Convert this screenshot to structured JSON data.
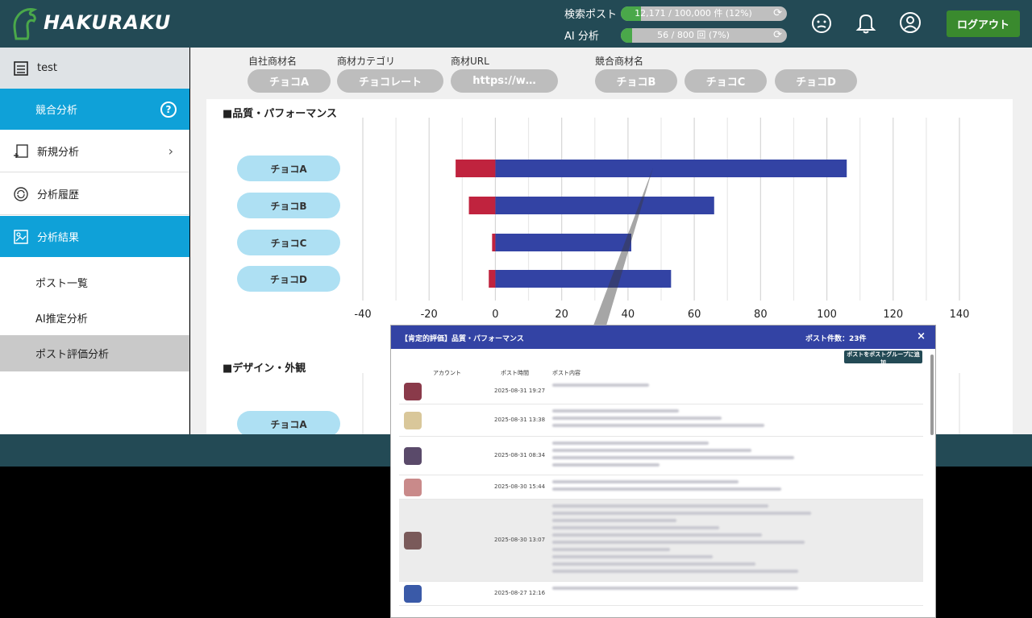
{
  "header": {
    "logo_text": "HAKURAKU",
    "search_posts": {
      "label": "検索ポスト",
      "value": "12,171 / 100,000 件 (12%)",
      "fraction": 0.12
    },
    "ai_analysis": {
      "label": "AI 分析",
      "value": "56 / 800 回 (7%)",
      "fraction": 0.07
    },
    "logout_label": "ログアウト"
  },
  "sidebar": {
    "project": "test",
    "competitive": "競合分析",
    "new_analysis": "新規分析",
    "history": "分析履歴",
    "results": "分析結果",
    "sub_items": [
      "ポスト一覧",
      "AI推定分析",
      "ポスト評価分析"
    ]
  },
  "filters": {
    "own_product_label": "自社商材名",
    "own_product": "チョコA",
    "category_label": "商材カテゴリ",
    "category": "チョコレート",
    "url_label": "商材URL",
    "url": "https://w…",
    "competitor_label": "競合商材名",
    "competitors": [
      "チョコB",
      "チョコC",
      "チョコD"
    ]
  },
  "sections": {
    "quality": "■品質・パフォーマンス",
    "design": "■デザイン・外観",
    "design_first_product": "チョコA"
  },
  "chart_data": {
    "type": "bar",
    "orientation": "horizontal",
    "categories": [
      "チョコA",
      "チョコB",
      "チョコC",
      "チョコD"
    ],
    "series": [
      {
        "values": [
          -12,
          -8,
          -1,
          -2
        ],
        "color": "#c0233e"
      },
      {
        "values": [
          106,
          66,
          41,
          53
        ],
        "color": "#3343a4"
      }
    ],
    "xlim": [
      -40,
      140
    ],
    "xticks": [
      -40,
      -20,
      0,
      20,
      40,
      60,
      80,
      100,
      120,
      140
    ],
    "grid": true
  },
  "modal": {
    "title": "【肯定的評価】品質・パフォーマンス",
    "count": "ポスト件数：23件",
    "close": "×",
    "add_button": "ポストをポストグループに追加",
    "columns": [
      "アカウント",
      "ポスト時間",
      "ポスト内容"
    ],
    "rows": [
      {
        "date": "2025-08-31 19:27",
        "avatar": "#8a3a4a"
      },
      {
        "date": "2025-08-31 13:38",
        "avatar": "#d9c79a"
      },
      {
        "date": "2025-08-31 08:34",
        "avatar": "#5a4a6a"
      },
      {
        "date": "2025-08-30 15:44",
        "avatar": "#c98a8a"
      },
      {
        "date": "2025-08-30 13:07",
        "avatar": "#7a5a5a"
      },
      {
        "date": "2025-08-27 12:16",
        "avatar": "#3a5aa8"
      }
    ]
  }
}
